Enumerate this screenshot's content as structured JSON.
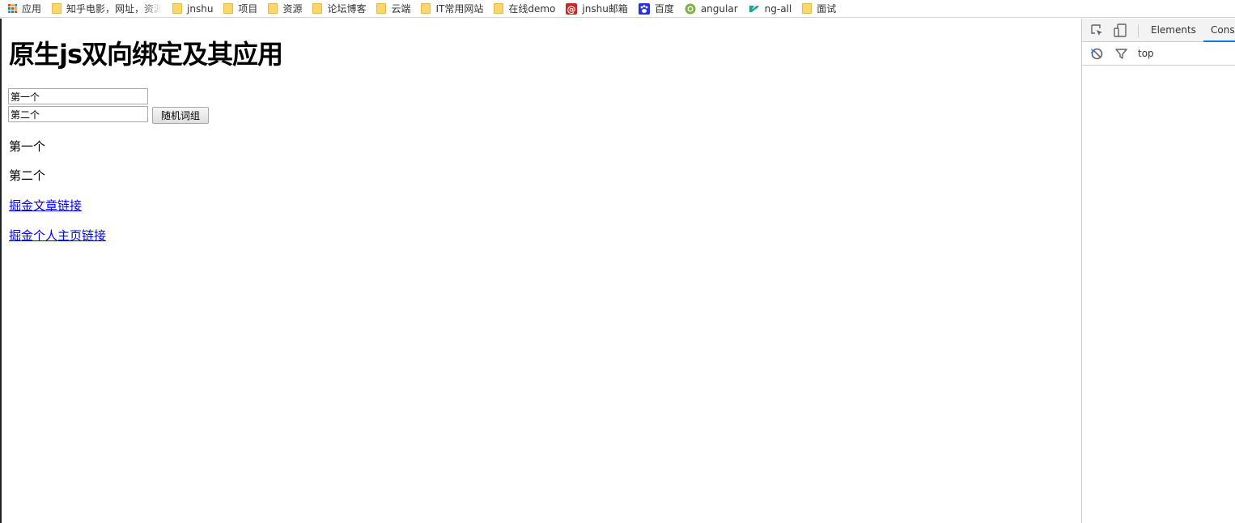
{
  "bookmarks": {
    "items": [
      {
        "label": "应用",
        "icon": "apps-grid-icon"
      },
      {
        "label": "知乎电影，网址，资源",
        "icon": "folder-icon"
      },
      {
        "label": "jnshu",
        "icon": "folder-icon"
      },
      {
        "label": "项目",
        "icon": "folder-icon"
      },
      {
        "label": "资源",
        "icon": "folder-icon"
      },
      {
        "label": "论坛博客",
        "icon": "folder-icon"
      },
      {
        "label": "云端",
        "icon": "folder-icon"
      },
      {
        "label": "IT常用网站",
        "icon": "folder-icon"
      },
      {
        "label": "在线demo",
        "icon": "folder-icon"
      },
      {
        "label": "jnshu邮箱",
        "icon": "mail-icon"
      },
      {
        "label": "百度",
        "icon": "baidu-paw-icon"
      },
      {
        "label": "angular",
        "icon": "angular-icon"
      },
      {
        "label": "ng-all",
        "icon": "ng-all-icon"
      },
      {
        "label": "面试",
        "icon": "folder-icon"
      }
    ]
  },
  "page": {
    "title": "原生js双向绑定及其应用",
    "input1_value": "第一个",
    "input2_value": "第二个",
    "random_button_label": "随机词组",
    "output1": "第一个",
    "output2": "第二个",
    "link1": "掘金文章链接",
    "link2": "掘金个人主页链接"
  },
  "devtools": {
    "tabs": {
      "elements": "Elements",
      "console": "Cons"
    },
    "context": "top",
    "prompt": "›"
  },
  "colors": {
    "link": "#0000ee",
    "devtools_accent": "#1a73e8",
    "folder": "#fbd66b"
  }
}
